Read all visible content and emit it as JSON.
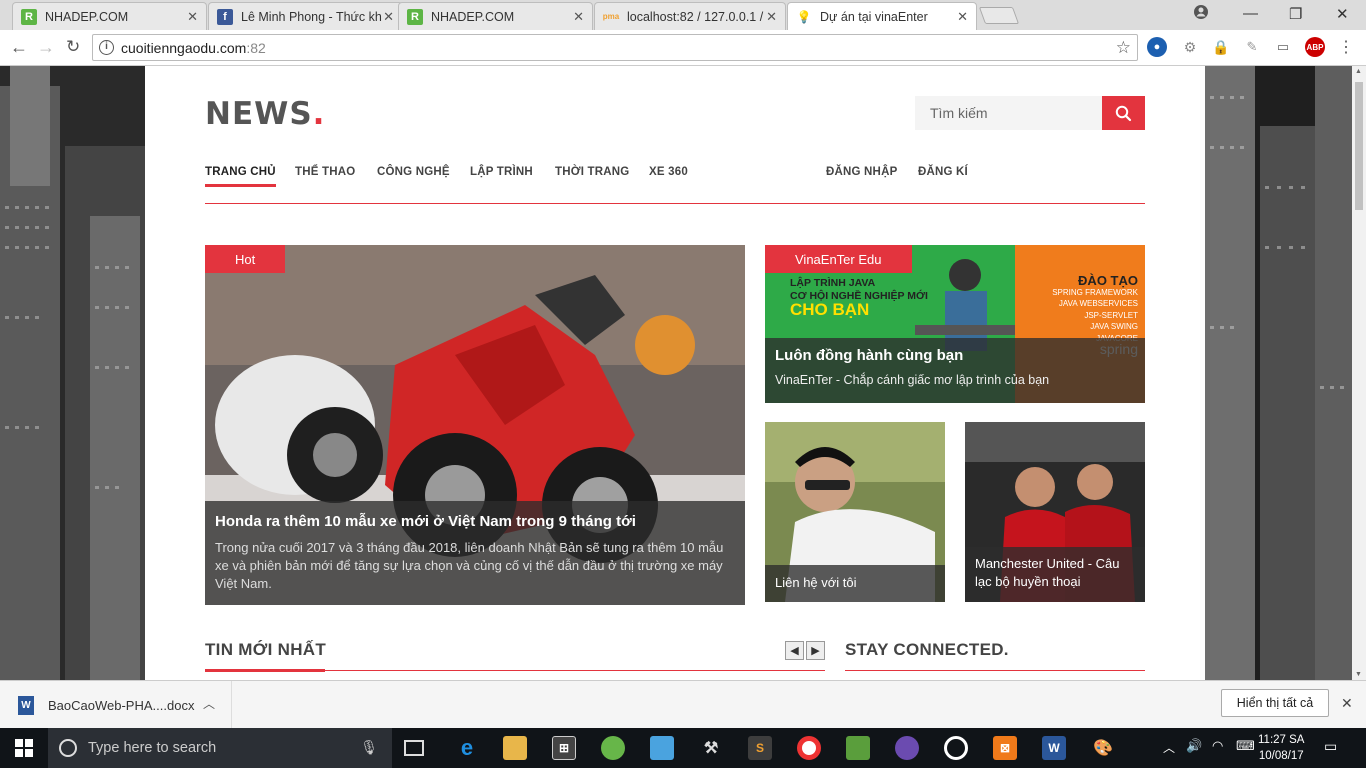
{
  "browser": {
    "tabs": [
      {
        "title": "NHADEP.COM",
        "favicon": "R",
        "color": "#5db545"
      },
      {
        "title": "Lê Minh Phong - Thức kh",
        "favicon": "f",
        "color": "#3b5998"
      },
      {
        "title": "NHADEP.COM",
        "favicon": "R",
        "color": "#5db545"
      },
      {
        "title": "localhost:82 / 127.0.0.1 /",
        "favicon": "pma",
        "color": "#f0a030"
      },
      {
        "title": "Dự án tại vinaEnter",
        "favicon": "💡",
        "color": "#ffffff"
      }
    ],
    "url_host": "cuoitienngaodu.com",
    "url_port": ":82",
    "extensions": [
      "ABP"
    ]
  },
  "site": {
    "logo": "NEWS",
    "logo_dot": ".",
    "search_placeholder": "Tìm kiếm",
    "nav": [
      "TRANG CHỦ",
      "THỂ THAO",
      "CÔNG NGHỆ",
      "LẬP TRÌNH",
      "THỜI TRANG",
      "XE 360"
    ],
    "auth": [
      "ĐĂNG NHẬP",
      "ĐĂNG KÍ"
    ],
    "accent": "#e3343e"
  },
  "featured": {
    "badge": "Hot",
    "title": "Honda ra thêm 10 mẫu xe mới ở Việt Nam trong 9 tháng tới",
    "excerpt": "Trong nửa cuối 2017 và 3 tháng đầu 2018, liên doanh Nhật Bản sẽ tung ra thêm 10 mẫu xe và phiên bản mới để tăng sự lựa chọn và củng cố vị thế dẫn đầu ở thị trường xe máy Việt Nam."
  },
  "promo": {
    "badge": "VinaEnTer Edu",
    "title": "Luôn đồng hành cùng bạn",
    "subtitle": "VinaEnTer - Chắp cánh giấc mơ lập trình của bạn",
    "banner_lines": [
      "LẬP TRÌNH JAVA",
      "CƠ HỘI NGHỀ NGHIỆP MỚI",
      "CHO BẠN"
    ],
    "banner_right": [
      "ĐÀO TẠO",
      "SPRING FRAMEWORK",
      "JAVA WEBSERVICES",
      "JSP-SERVLET",
      "JAVA SWING",
      "JAVACORE",
      "spring"
    ]
  },
  "small_cards": [
    {
      "title": "Liên hệ với tôi"
    },
    {
      "title": "Manchester United - Câu lạc bộ huyền thoại"
    }
  ],
  "sections": {
    "latest": "TIN MỚI NHẤT",
    "connected": "STAY CONNECTED."
  },
  "download": {
    "filename": "BaoCaoWeb-PHA....docx",
    "show_all": "Hiển thị tất cả"
  },
  "taskbar": {
    "search_placeholder": "Type here to search",
    "time": "11:27 SA",
    "date": "10/08/17"
  }
}
